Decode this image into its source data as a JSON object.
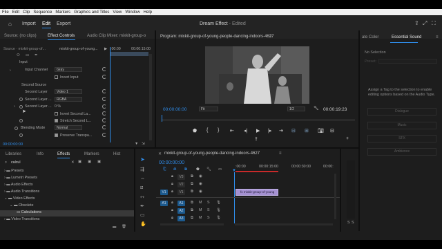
{
  "menu": [
    "File",
    "Edit",
    "Clip",
    "Sequence",
    "Markers",
    "Graphics and Titles",
    "View",
    "Window",
    "Help"
  ],
  "workspace": {
    "tabs": [
      "Import",
      "Edit",
      "Export"
    ],
    "title": "Dream Effect",
    "edited": "- Edited"
  },
  "left_top": {
    "tabs": [
      "Source: (no clips)",
      "Effect Controls",
      "Audio Clip Mixer: mixkit-group-o"
    ],
    "source_label": "Source · mixkit-group-of...",
    "clip_label": "mixkit-group-of-young...",
    "ruler_tc": ":00:00",
    "ruler_tc2": "00:00:15:00",
    "rows": {
      "input": "Input",
      "input_channel": "Input Channel",
      "input_channel_val": "Gray",
      "invert_input": "Invert Input",
      "second_source": "Second Source",
      "second_layer": "Second Layer",
      "second_layer_val": "Video 1",
      "second_layer2": "Second Layer ...",
      "second_layer2_val": "RGBA",
      "second_layer3": "Second Layer ...",
      "second_layer3_val": "0 %",
      "invert_second": "Invert Second La...",
      "stretch_second": "Stretch Second L...",
      "blending_mode": "Blending Mode",
      "blending_mode_val": "Normal",
      "preserve_transp": "Preserve Transpa..."
    },
    "footer_tc": "00:00:00:00"
  },
  "program": {
    "title": "Program: mixkit-group-of-young-people-dancing-indoors-4627",
    "tc_left": "00:00:00:00",
    "fit": "Fit",
    "zoom": "1/2",
    "tc_right": "00:00:19:23"
  },
  "project": {
    "tabs": [
      "Libraries",
      "Info",
      "Effects",
      "Markers",
      "Hist"
    ],
    "search": "calcul",
    "items": [
      "Presets",
      "Lumetri Presets",
      "Audio Effects",
      "Audio Transitions",
      "Video Effects",
      "Obsolete",
      "Calculations",
      "Video Transitions"
    ]
  },
  "timeline": {
    "title": "mixkit-group-of-young-people-dancing-indoors-4627",
    "tc": "00:00:00:00",
    "ruler": [
      ":00:00",
      "00:00:15:00",
      "00:00:30:00",
      "00:00:"
    ],
    "tracks": [
      "V3",
      "V2",
      "V1",
      "A1",
      "A2",
      "A3"
    ],
    "track_targets": [
      "V1",
      "A1"
    ],
    "track_ms": [
      "M",
      "S"
    ],
    "clip_label": "mixkit-group-of-young",
    "clip_badge": "fx"
  },
  "meters": {
    "labels": [
      "S",
      "S"
    ]
  },
  "essential": {
    "tabs": [
      "ate Color",
      "Essential Sound"
    ],
    "no_sel": "No Selection",
    "preset": "Preset:",
    "message": "Assign a Tag to the selection to enable editing options based on the Audio Type.",
    "buttons": [
      "Dialogue",
      "Music",
      "SFX",
      "Ambience"
    ]
  },
  "colors": {
    "accent": "#2f8eed",
    "clip": "#a591d2",
    "playhead_red": "#c92a2a"
  }
}
